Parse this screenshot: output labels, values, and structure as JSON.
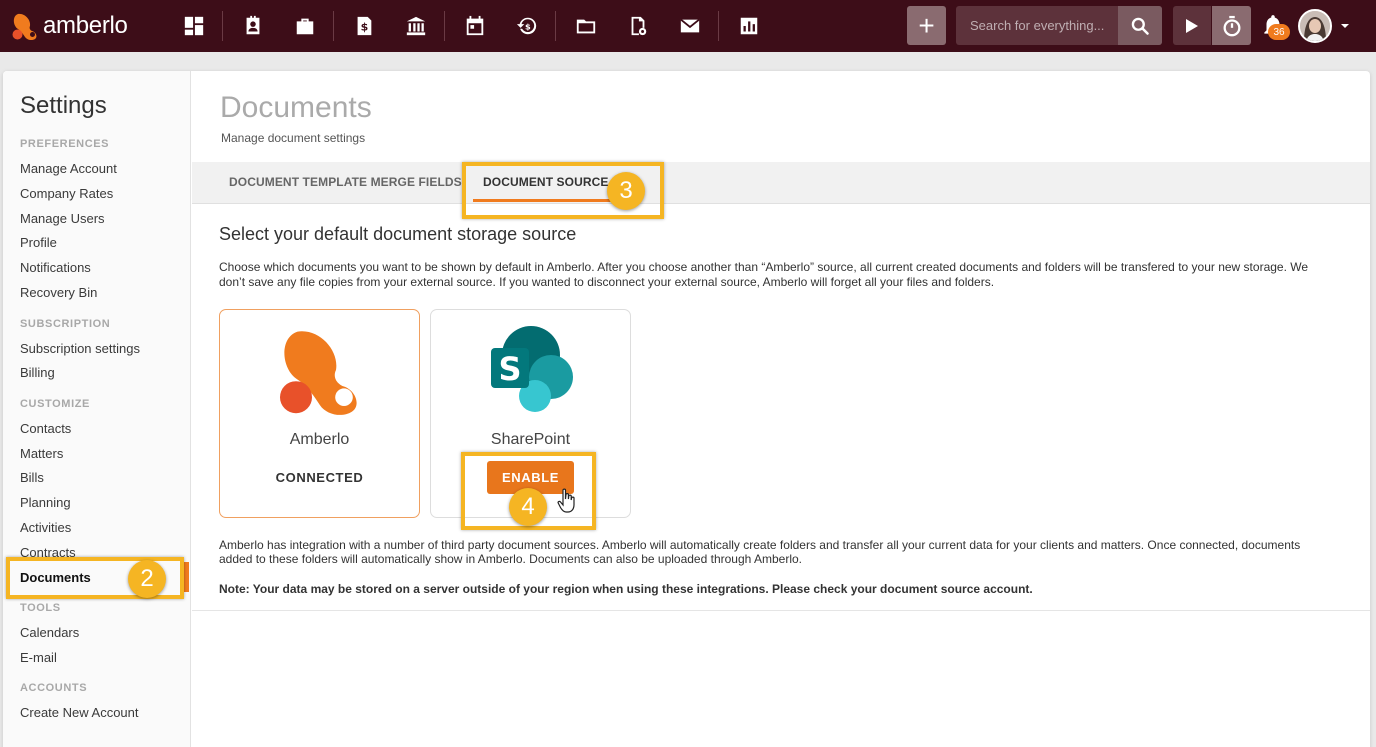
{
  "app": {
    "brand": "amberlo",
    "colors": {
      "topbar": "#3d0d18",
      "accent": "#f07b1e",
      "highlight": "#f5b523"
    }
  },
  "topnav": {
    "icons": [
      "dashboard-icon",
      "contacts-icon",
      "matters-icon",
      "bills-icon",
      "bank-icon",
      "calendar-icon",
      "history-icon",
      "folder-icon",
      "document-settings-icon",
      "mail-icon",
      "reports-icon"
    ],
    "add_label": "+",
    "search_placeholder": "Search for everything...",
    "notification_count": "36"
  },
  "sidebar": {
    "title": "Settings",
    "sections": [
      {
        "label": "PREFERENCES",
        "items": [
          "Manage Account",
          "Company Rates",
          "Manage Users",
          "Profile",
          "Notifications",
          "Recovery Bin"
        ]
      },
      {
        "label": "SUBSCRIPTION",
        "items": [
          "Subscription settings",
          "Billing"
        ]
      },
      {
        "label": "CUSTOMIZE",
        "items": [
          "Contacts",
          "Matters",
          "Bills",
          "Planning",
          "Activities",
          "Contracts",
          "Documents"
        ]
      },
      {
        "label": "TOOLS",
        "items": [
          "Calendars",
          "E-mail"
        ]
      },
      {
        "label": "ACCOUNTS",
        "items": [
          "Create New Account"
        ]
      }
    ],
    "active_item": "Documents"
  },
  "page": {
    "title": "Documents",
    "subtitle": "Manage document settings",
    "tabs": [
      {
        "label": "DOCUMENT TEMPLATE MERGE FIELDS",
        "active": false
      },
      {
        "label": "DOCUMENT SOURCE",
        "active": true
      }
    ],
    "section_heading": "Select your default document storage source",
    "description": "Choose which documents you want to be shown by default in Amberlo. After you choose another than “Amberlo” source, all current created documents and folders will be transfered to your new storage. We don’t save any file copies from your external source. If you wanted to disconnect your external source, Amberlo will forget all your files and folders.",
    "sources": [
      {
        "name": "Amberlo",
        "status": "CONNECTED",
        "logo": "amberlo-logo"
      },
      {
        "name": "SharePoint",
        "action": "ENABLE",
        "logo": "sharepoint-logo"
      }
    ],
    "info": "Amberlo has integration with a number of third party document sources. Amberlo will automatically create folders and transfer all your current data for your clients and matters. Once connected, documents added to these folders will automatically show in Amberlo. Documents can also be uploaded through Amberlo.",
    "note": "Note: Your data may be stored on a server outside of your region when using these integrations. Please check your document source account."
  },
  "annotations": {
    "steps": [
      "2",
      "3",
      "4"
    ]
  }
}
